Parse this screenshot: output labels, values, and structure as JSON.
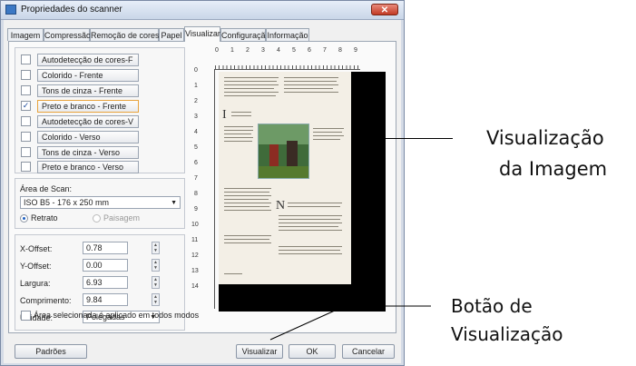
{
  "window": {
    "title": "Propriedades do scanner",
    "close_label": "✕"
  },
  "tabs": [
    {
      "label": "Imagem"
    },
    {
      "label": "Compressão"
    },
    {
      "label": "Remoção de cores"
    },
    {
      "label": "Papel"
    },
    {
      "label": "Visualizar"
    },
    {
      "label": "Configuração"
    },
    {
      "label": "Informação"
    }
  ],
  "active_tab": "Visualizar",
  "image_types": [
    {
      "label": "Autodetecção de cores-F",
      "checked": false
    },
    {
      "label": "Colorido - Frente",
      "checked": false
    },
    {
      "label": "Tons de cinza - Frente",
      "checked": false
    },
    {
      "label": "Preto e branco - Frente",
      "checked": true
    },
    {
      "label": "Autodetecção de cores-V",
      "checked": false
    },
    {
      "label": "Colorido - Verso",
      "checked": false
    },
    {
      "label": "Tons de cinza - Verso",
      "checked": false
    },
    {
      "label": "Preto e branco - Verso",
      "checked": false
    }
  ],
  "scan_area": {
    "label": "Área de Scan:",
    "value": "ISO B5 - 176 x 250 mm",
    "orientation_portrait": "Retrato",
    "orientation_landscape": "Paisagem"
  },
  "fields": {
    "x_offset_label": "X-Offset:",
    "x_offset": "0.78",
    "y_offset_label": "Y-Offset:",
    "y_offset": "0.00",
    "width_label": "Largura:",
    "width": "6.93",
    "length_label": "Comprimento:",
    "length": "9.84",
    "unit_label": "Unidade:",
    "unit": "Polegadas",
    "apply_all_label": "Área selecionada é aplicado em todos modos"
  },
  "ruler": {
    "top": [
      "0",
      "1",
      "2",
      "3",
      "4",
      "5",
      "6",
      "7",
      "8",
      "9"
    ],
    "left": [
      "0",
      "1",
      "2",
      "3",
      "4",
      "5",
      "6",
      "7",
      "8",
      "9",
      "10",
      "11",
      "12",
      "13",
      "14"
    ]
  },
  "buttons": {
    "defaults": "Padrões",
    "preview": "Visualizar",
    "ok": "OK",
    "cancel": "Cancelar"
  },
  "annotations": {
    "image_preview_line1": "Visualização",
    "image_preview_line2": "da Imagem",
    "preview_button_line1": "Botão de",
    "preview_button_line2": "Visualização"
  }
}
